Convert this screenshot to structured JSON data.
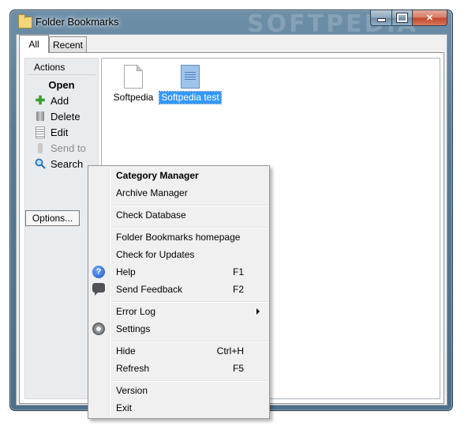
{
  "window": {
    "title": "Folder Bookmarks",
    "watermark": "SOFTPEDIA"
  },
  "tabs": [
    {
      "label": "All"
    },
    {
      "label": "Recent"
    }
  ],
  "actions": {
    "header": "Actions",
    "open": "Open",
    "add": "Add",
    "delete": "Delete",
    "edit": "Edit",
    "send_to": "Send to",
    "search": "Search",
    "options": "Options..."
  },
  "files": [
    {
      "name": "Softpedia",
      "selected": false
    },
    {
      "name": "Softpedia test",
      "selected": true
    }
  ],
  "menu": {
    "category_manager": "Category Manager",
    "archive_manager": "Archive Manager",
    "check_database": "Check Database",
    "homepage": "Folder Bookmarks homepage",
    "check_updates": "Check for Updates",
    "help": {
      "label": "Help",
      "shortcut": "F1"
    },
    "send_feedback": {
      "label": "Send Feedback",
      "shortcut": "F2"
    },
    "error_log": "Error Log",
    "settings": "Settings",
    "hide": {
      "label": "Hide",
      "shortcut": "Ctrl+H"
    },
    "refresh": {
      "label": "Refresh",
      "shortcut": "F5"
    },
    "version": "Version",
    "exit": "Exit"
  }
}
